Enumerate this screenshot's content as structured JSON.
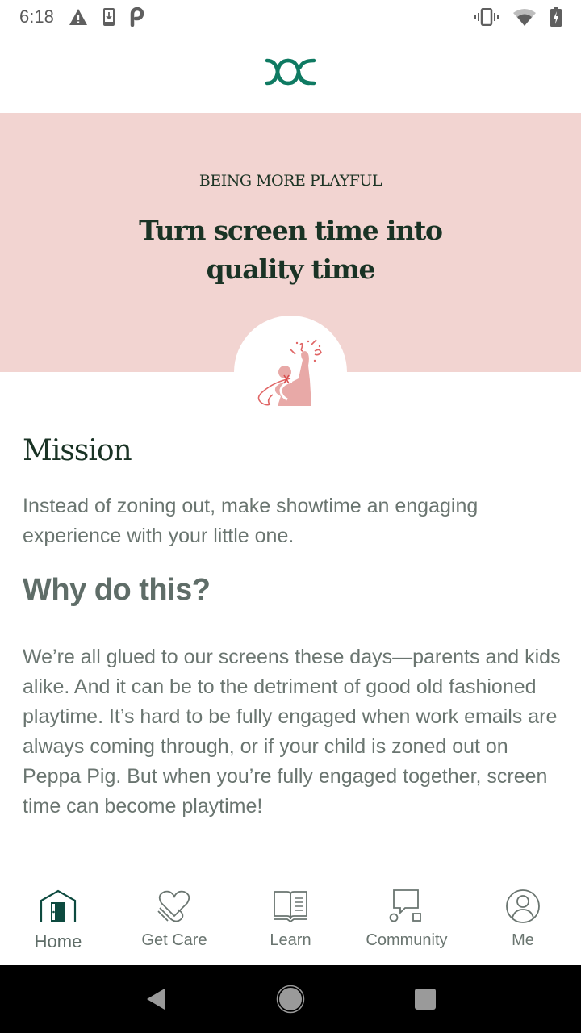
{
  "status_bar": {
    "time": "6:18",
    "left_icons": [
      "warning-icon",
      "download-icon",
      "parking-app-icon"
    ],
    "right_icons": [
      "vibrate-icon",
      "wifi-icon",
      "battery-charging-icon"
    ]
  },
  "header": {
    "logo": "brand-logo-icon",
    "brand_color": "#0f7a62"
  },
  "hero": {
    "eyebrow": "BEING MORE PLAYFUL",
    "title": "Turn screen time into quality time",
    "background_color": "#f2d4d1",
    "illustration": "celebrating-person-illustration"
  },
  "content": {
    "mission_heading": "Mission",
    "mission_text": "Instead of zoning out, make showtime an engaging experience with your little one.",
    "why_heading": "Why do this?",
    "why_text": "We’re all glued to our screens these days—parents and kids alike. And it can be to the detriment of good old fashioned playtime. It’s hard to be fully engaged when work emails are always coming through, or if your child is zoned out on Peppa Pig. But when you’re fully engaged together, screen time can become playtime!"
  },
  "bottom_nav": {
    "items": [
      {
        "label": "Home",
        "icon": "home-icon",
        "active": true
      },
      {
        "label": "Get Care",
        "icon": "heart-hand-icon",
        "active": false
      },
      {
        "label": "Learn",
        "icon": "book-icon",
        "active": false
      },
      {
        "label": "Community",
        "icon": "community-icon",
        "active": false
      },
      {
        "label": "Me",
        "icon": "profile-icon",
        "active": false
      }
    ]
  },
  "system_nav": {
    "buttons": [
      "back-icon",
      "home-circle-icon",
      "recents-icon"
    ]
  }
}
